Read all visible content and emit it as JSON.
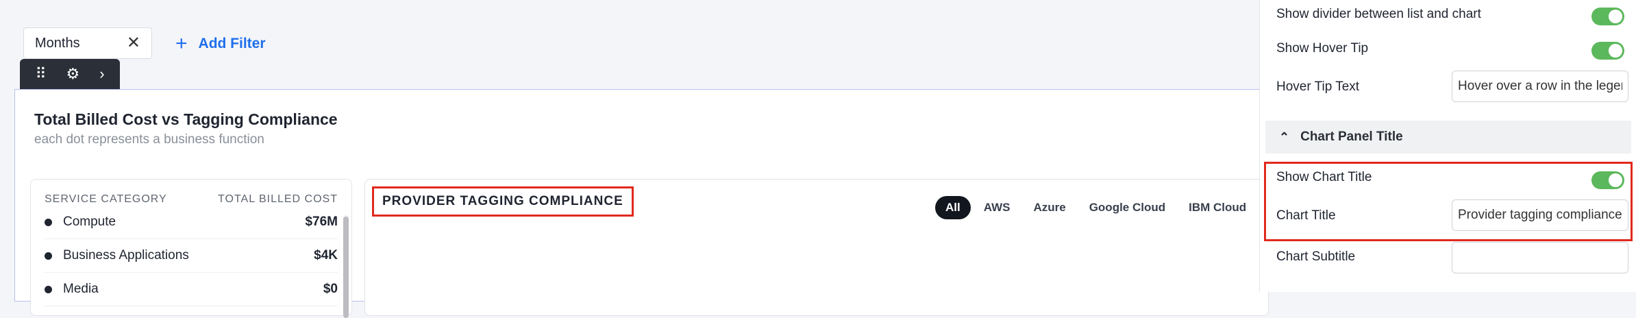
{
  "filters": {
    "chip_label": "Months",
    "chip_close_glyph": "✕",
    "add_filter_plus": "+",
    "add_filter_label": "Add Filter"
  },
  "toolbar": {
    "drag_glyph": "⠿",
    "gear_glyph": "⚙",
    "chevron_glyph": "›"
  },
  "card": {
    "title": "Total Billed Cost vs Tagging Compliance",
    "subtitle": "each dot represents a business function"
  },
  "list": {
    "col_category": "SERVICE CATEGORY",
    "col_cost": "TOTAL BILLED COST",
    "rows": [
      {
        "name": "Compute",
        "value": "$76M"
      },
      {
        "name": "Business Applications",
        "value": "$4K"
      },
      {
        "name": "Media",
        "value": "$0"
      }
    ]
  },
  "chart": {
    "title": "PROVIDER TAGGING COMPLIANCE",
    "tabs": [
      "All",
      "AWS",
      "Azure",
      "Google Cloud",
      "IBM Cloud"
    ],
    "active_tab": "All"
  },
  "panel": {
    "show_divider_label": "Show divider between list and chart",
    "show_hover_tip_label": "Show Hover Tip",
    "hover_tip_text_label": "Hover Tip Text",
    "hover_tip_text_value": "Hover over a row in the legend",
    "section_title": "Chart Panel Title",
    "section_chevron": "⌃",
    "show_chart_title_label": "Show Chart Title",
    "chart_title_label": "Chart Title",
    "chart_title_value": "Provider tagging compliance",
    "chart_subtitle_label": "Chart Subtitle",
    "chart_subtitle_value": "",
    "toggles": {
      "divider": true,
      "hover_tip": true,
      "chart_title": true
    }
  },
  "colors": {
    "accent": "#1f6feb",
    "toggle_on": "#5cb85c",
    "highlight": "#e0291d",
    "active_tab": "#12161f"
  }
}
